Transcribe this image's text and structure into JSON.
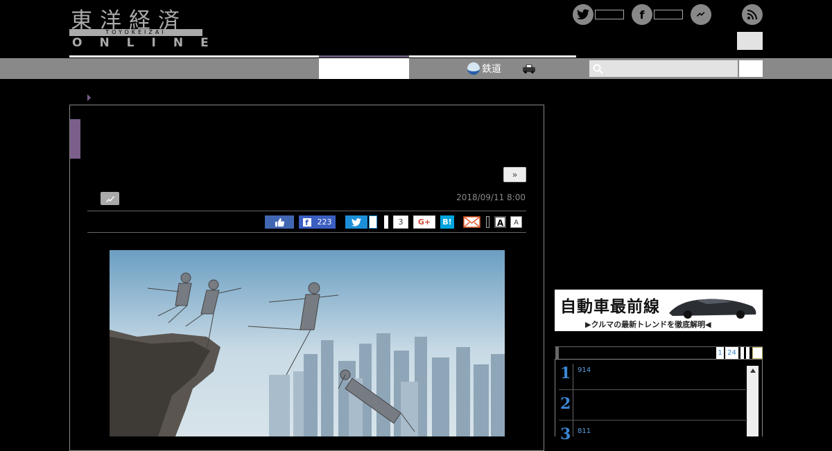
{
  "header": {
    "logo_kanji": "東洋経済",
    "logo_sub": "TOYOKEIZAI",
    "logo_online": "ONLINE"
  },
  "nav": {
    "items": [
      {
        "label": "鉄道",
        "icon": "train-icon"
      },
      {
        "label": "",
        "icon": "car-icon"
      }
    ],
    "search_placeholder": ""
  },
  "article": {
    "next_label": "»",
    "date": "2018/09/11 8:00",
    "share": {
      "facebook_count": "223",
      "pocket_count": "3",
      "gplus_label": "G+",
      "hatena_label": "B!",
      "font_large": "A",
      "font_small": "A"
    }
  },
  "sidebar": {
    "banner_title": "自動車最前線",
    "banner_sub": "▶クルマの最新トレンドを徹底解明◀",
    "ranking_tabs": [
      "1",
      "24"
    ],
    "ranking": [
      {
        "rank": "1",
        "count": "914"
      },
      {
        "rank": "2",
        "count": ""
      },
      {
        "rank": "3",
        "count": "811"
      }
    ]
  },
  "colors": {
    "accent_purple": "#7b5e8a",
    "nav_gray": "#898989",
    "twitter_blue": "#1d8fd8",
    "facebook_blue": "#3b5ec1",
    "rank_blue": "#3a88d8"
  }
}
